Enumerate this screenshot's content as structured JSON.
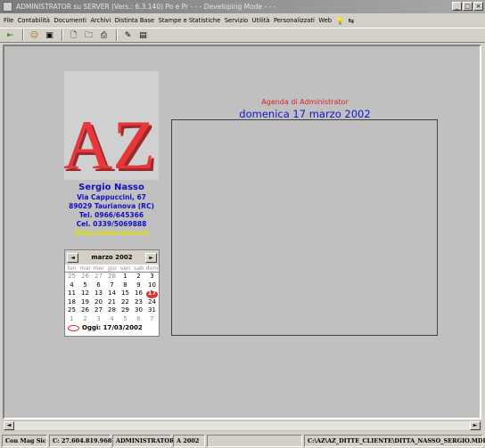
{
  "window": {
    "title": "ADMINISTRATOR su SERVER (Vers.: 6.3.140) Po e Pr   - - - Developing Mode - - -",
    "controls": [
      "_",
      "□",
      "×"
    ]
  },
  "menu": {
    "items": [
      "File",
      "Contabilità",
      "Documenti",
      "Archivi",
      "Distinta Base",
      "Stampe e Statistiche",
      "Servizio",
      "Utilità",
      "Personalizzati",
      "Web"
    ]
  },
  "logo": {
    "text": "AZ",
    "color": "#e8373a"
  },
  "company": {
    "name": "Sergio Nasso",
    "address": "Via Cappuccini, 67",
    "city": "89029 Taurianova (RC)",
    "tel": "Tel. 0966/645366",
    "cel": "Cel. 0339/5069888",
    "web": "http://www.nasso.it"
  },
  "agenda": {
    "label": "Agenda di Administrator",
    "date": "domenica 17 marzo 2002"
  },
  "calendar": {
    "title": "marzo 2002",
    "prev": "◄",
    "next": "►",
    "weekdays": [
      "lun",
      "mar",
      "mer",
      "gio",
      "ven",
      "sab",
      "dom"
    ],
    "rows": [
      [
        "25",
        "26",
        "27",
        "28",
        "1",
        "2",
        "3"
      ],
      [
        "4",
        "5",
        "6",
        "7",
        "8",
        "9",
        "10"
      ],
      [
        "11",
        "12",
        "13",
        "14",
        "15",
        "16",
        "17"
      ],
      [
        "18",
        "19",
        "20",
        "21",
        "22",
        "23",
        "24"
      ],
      [
        "25",
        "26",
        "27",
        "28",
        "29",
        "30",
        "31"
      ],
      [
        "1",
        "2",
        "3",
        "4",
        "5",
        "6",
        "7"
      ]
    ],
    "today_label": "Oggi: 17/03/2002"
  },
  "status": {
    "panels": [
      "Con Mag Sic",
      "C: 27.604.819.968",
      "ADMINISTRATOR",
      "A 2002",
      "",
      "C:\\AZ\\AZ_DITTE_CLIENTE\\DITTA_NASSO_SERGIO.MDB"
    ]
  }
}
